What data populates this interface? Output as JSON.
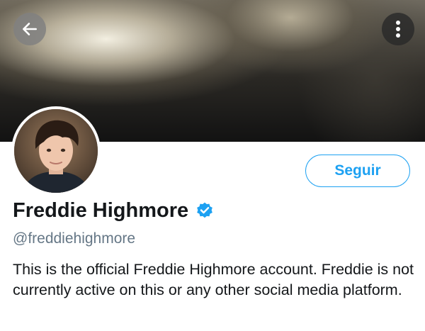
{
  "header": {
    "back_icon": "arrow-left-icon",
    "more_icon": "more-vertical-icon"
  },
  "profile": {
    "name": "Freddie Highmore",
    "handle": "@freddiehighmore",
    "verified_icon": "verified-badge-icon",
    "bio": "This is the official Freddie Highmore account. Freddie is not currently active on this or any other social media platform.",
    "follow_label": "Seguir"
  },
  "colors": {
    "accent": "#1da1f2",
    "secondary_text": "#657786",
    "primary_text": "#14171a"
  }
}
